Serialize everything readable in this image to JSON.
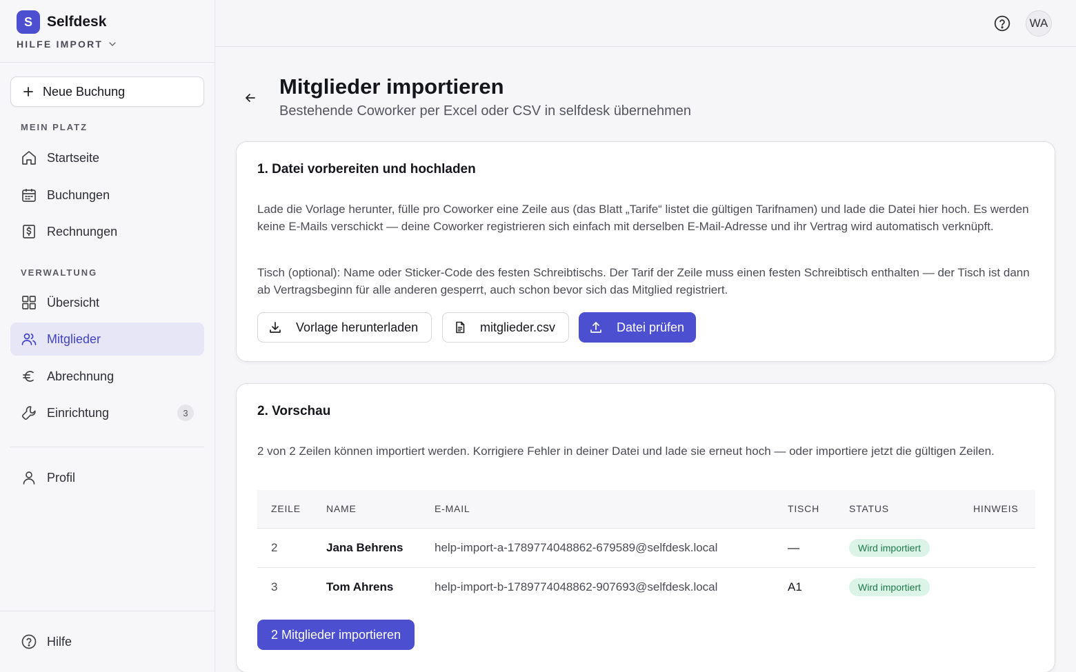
{
  "brand": {
    "logo_letter": "S",
    "name": "Selfdesk",
    "workspace": "HILFE IMPORT"
  },
  "sidebar": {
    "new_booking": "Neue Buchung",
    "section_my_place": "MEIN PLATZ",
    "section_admin": "VERWALTUNG",
    "items": [
      {
        "label": "Startseite",
        "icon": "home-icon"
      },
      {
        "label": "Buchungen",
        "icon": "calendar-icon"
      },
      {
        "label": "Rechnungen",
        "icon": "invoice-icon"
      },
      {
        "label": "Übersicht",
        "icon": "grid-icon"
      },
      {
        "label": "Mitglieder",
        "icon": "users-icon",
        "active": true
      },
      {
        "label": "Abrechnung",
        "icon": "euro-icon"
      },
      {
        "label": "Einrichtung",
        "icon": "wrench-icon",
        "badge": "3"
      },
      {
        "label": "Profil",
        "icon": "user-icon"
      }
    ],
    "help": "Hilfe"
  },
  "topbar": {
    "avatar_initials": "WA"
  },
  "header": {
    "title": "Mitglieder importieren",
    "subtitle": "Bestehende Coworker per Excel oder CSV in selfdesk übernehmen"
  },
  "step1": {
    "title": "1. Datei vorbereiten und hochladen",
    "paragraph1": "Lade die Vorlage herunter, fülle pro Coworker eine Zeile aus (das Blatt „Tarife“ listet die gültigen Tarifnamen) und lade die Datei hier hoch. Es werden keine E-Mails verschickt — deine Coworker registrieren sich einfach mit derselben E-Mail-Adresse und ihr Vertrag wird automatisch verknüpft.",
    "paragraph2": "Tisch (optional): Name oder Sticker-Code des festen Schreibtischs. Der Tarif der Zeile muss einen festen Schreibtisch enthalten — der Tisch ist dann ab Vertragsbeginn für alle anderen gesperrt, auch schon bevor sich das Mitglied registriert.",
    "download_label": "Vorlage herunterladen",
    "file_name": "mitglieder.csv",
    "check_label": "Datei prüfen"
  },
  "step2": {
    "title": "2. Vorschau",
    "summary": "2 von 2 Zeilen können importiert werden. Korrigiere Fehler in deiner Datei und lade sie erneut hoch — oder importiere jetzt die gültigen Zeilen.",
    "columns": {
      "row": "ZEILE",
      "name": "NAME",
      "email": "E-MAIL",
      "desk": "TISCH",
      "status": "STATUS",
      "note": "HINWEIS"
    },
    "rows": [
      {
        "row": "2",
        "name": "Jana Behrens",
        "email": "help-import-a-1789774048862-679589@selfdesk.local",
        "desk": "—",
        "status": "Wird importiert",
        "note": ""
      },
      {
        "row": "3",
        "name": "Tom Ahrens",
        "email": "help-import-b-1789774048862-907693@selfdesk.local",
        "desk": "A1",
        "status": "Wird importiert",
        "note": ""
      }
    ],
    "import_label": "2 Mitglieder importieren"
  },
  "colors": {
    "accent": "#4c4fd0",
    "success_bg": "#dcf4e7",
    "success_text": "#1b7a45"
  }
}
